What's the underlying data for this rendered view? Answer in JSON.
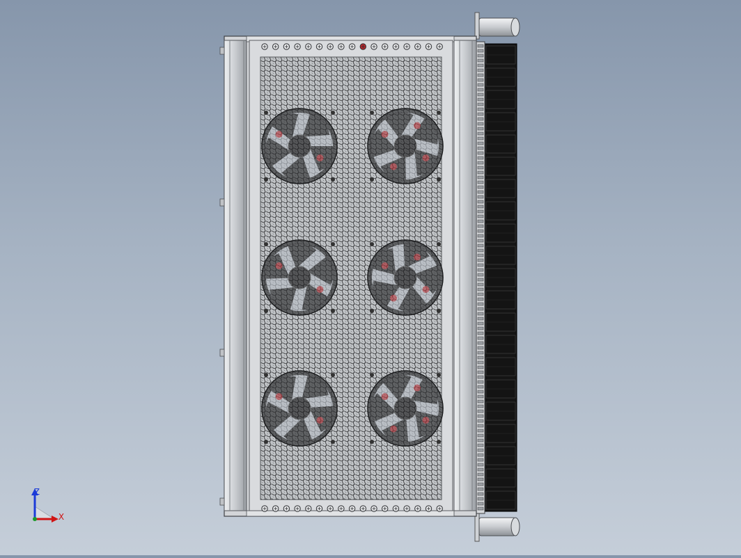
{
  "viewport": {
    "background_top": "#8696ab",
    "background_bottom": "#c5ced9",
    "model": {
      "frame_color": "#d2d4d7",
      "mesh_color": "#b7babd",
      "hole_color": "#2b2c2e",
      "fan_blade_color": "#1c1c1e",
      "fan_hub_color": "#cfd6df",
      "fan_accent_color": "#b5262b",
      "heatsink_color": "#141414",
      "rail_color": "#7a7d81"
    }
  },
  "triad": {
    "z_label": "Z",
    "x_label": "X",
    "z_color": "#1c3bd8",
    "x_color": "#d01414"
  }
}
